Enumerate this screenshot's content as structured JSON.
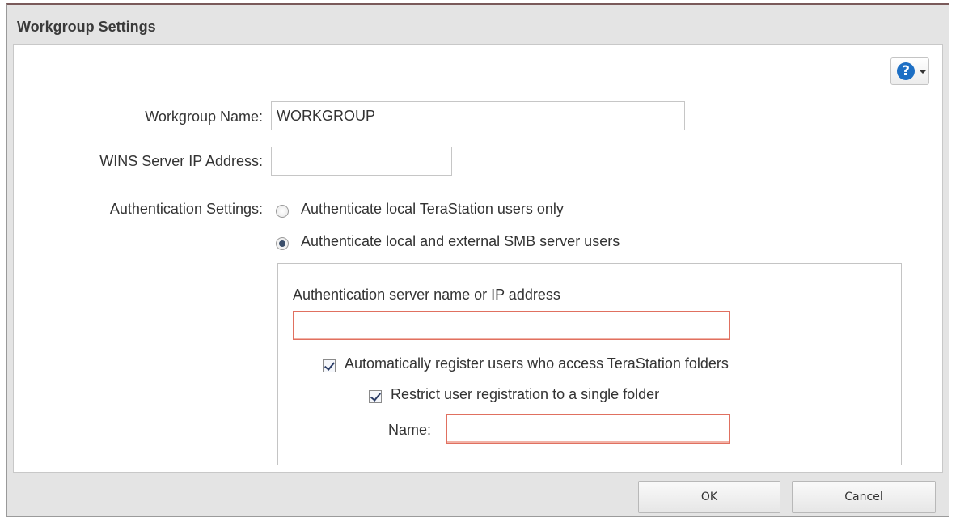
{
  "dialog": {
    "title": "Workgroup Settings"
  },
  "help": {
    "icon": "help-question-icon",
    "glyph": "?"
  },
  "workgroup_name": {
    "label": "Workgroup Name:",
    "value": "WORKGROUP"
  },
  "wins_server": {
    "label": "WINS Server IP Address:",
    "value": ""
  },
  "authentication": {
    "label": "Authentication Settings:",
    "options": [
      {
        "label": "Authenticate local TeraStation users only",
        "selected": false
      },
      {
        "label": "Authenticate local and external SMB server users",
        "selected": true
      }
    ]
  },
  "auth_server": {
    "label": "Authentication server name or IP address",
    "value": ""
  },
  "auto_register": {
    "label": "Automatically register users who access TeraStation folders",
    "checked": true
  },
  "restrict_registration": {
    "label": "Restrict user registration to a single folder",
    "checked": true
  },
  "folder_name": {
    "label": "Name:",
    "value": ""
  },
  "buttons": {
    "ok": "OK",
    "cancel": "Cancel"
  }
}
